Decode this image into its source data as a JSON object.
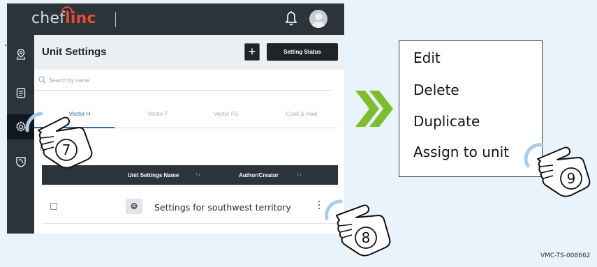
{
  "app": {
    "logo_prefix": "chef",
    "logo_suffix": "linc",
    "page_title": "Unit Settings",
    "add_button": "+",
    "setting_status_button": "Setting Status",
    "search_placeholder": "Search by name",
    "tabs": [
      {
        "label": "Vector H",
        "active": true
      },
      {
        "label": "Vector F",
        "active": false
      },
      {
        "label": "Vector FG",
        "active": false
      },
      {
        "label": "Cook & Hold",
        "active": false
      }
    ],
    "table": {
      "columns": [
        {
          "label": "Unit Settings Name",
          "sort": "↑↓"
        },
        {
          "label": "Author/Creator",
          "sort": "↑↓"
        }
      ],
      "rows": [
        {
          "name": "Settings for southwest territory"
        }
      ]
    },
    "sidebar_icons": [
      "location-icon",
      "clipboard-icon",
      "gear-icon",
      "wrench-shield-icon"
    ],
    "active_sidebar": "gear-icon"
  },
  "context_menu": {
    "items": [
      "Edit",
      "Delete",
      "Duplicate",
      "Assign to unit"
    ]
  },
  "callouts": {
    "step_7": "⑦",
    "step_8": "⑧",
    "step_9": "⑨"
  },
  "document_code": "VMC-TS-008662",
  "colors": {
    "dark_bar": "#2b333b",
    "brand_red": "#e54b2e",
    "tab_active": "#2a6dad",
    "arrow_green": "#7dbd2f",
    "highlight_blue": "#a9cce8"
  }
}
